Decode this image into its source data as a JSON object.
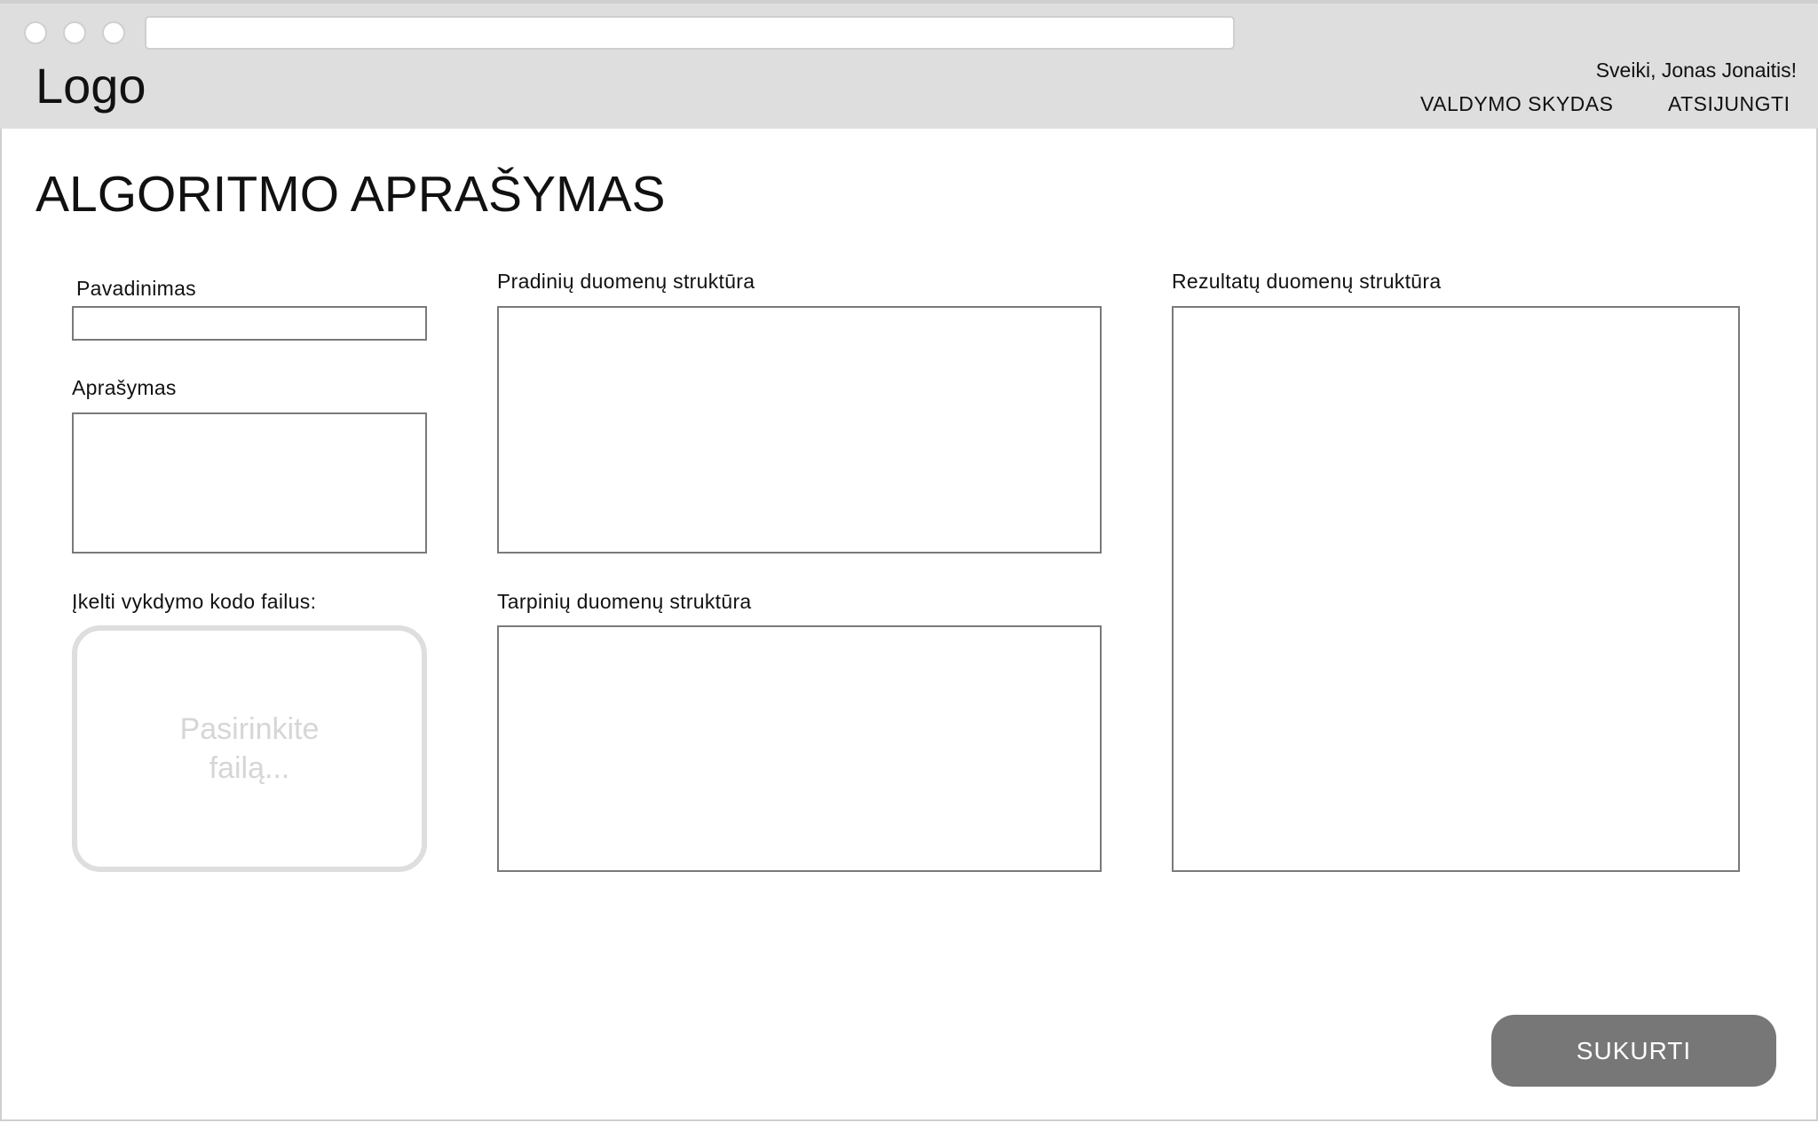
{
  "header": {
    "logo": "Logo",
    "greeting": "Sveiki, Jonas Jonaitis!",
    "nav": [
      "VALDYMO SKYDAS",
      "ATSIJUNGTI"
    ]
  },
  "page": {
    "title": "ALGORITMO APRAŠYMAS"
  },
  "form": {
    "name_label": "Pavadinimas",
    "name_value": "",
    "description_label": "Aprašymas",
    "description_value": "",
    "upload_label": "Įkelti vykdymo kodo failus:",
    "upload_placeholder": "Pasirinkite failą...",
    "input_structure_label": "Pradinių duomenų struktūra",
    "intermediate_structure_label": "Tarpinių duomenų struktūra",
    "result_structure_label": "Rezultatų duomenų struktūra",
    "submit_label": "SUKURTI"
  },
  "colors": {
    "header_bg": "#dedede",
    "button_bg": "#777777",
    "border": "#7a7a7a"
  }
}
